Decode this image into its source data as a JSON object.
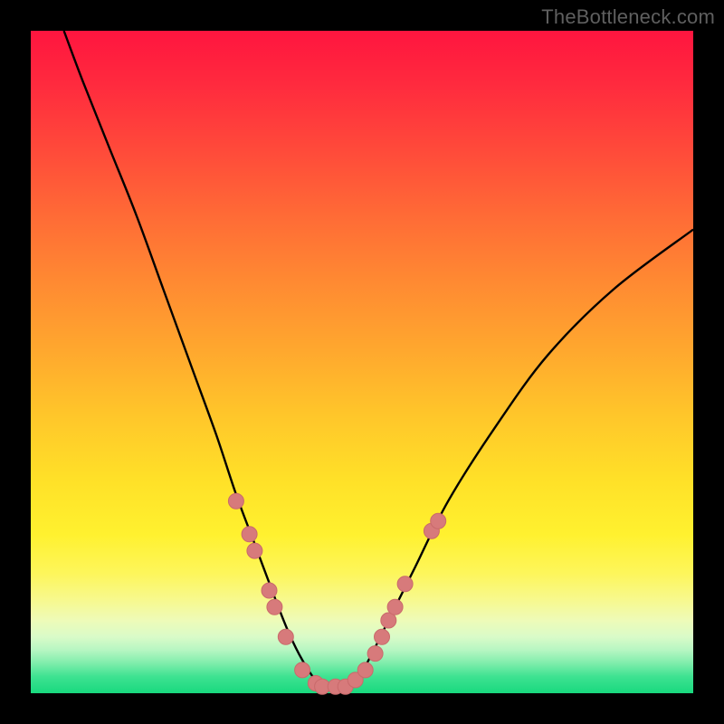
{
  "watermark": "TheBottleneck.com",
  "colors": {
    "frame": "#000000",
    "curve": "#000000",
    "marker_fill": "#d77a7b",
    "marker_stroke": "#c96a6b"
  },
  "chart_data": {
    "type": "line",
    "title": "",
    "xlabel": "",
    "ylabel": "",
    "xlim": [
      0,
      100
    ],
    "ylim": [
      0,
      100
    ],
    "grid": false,
    "legend": false,
    "annotations": [
      "TheBottleneck.com"
    ],
    "series": [
      {
        "name": "bottleneck-curve",
        "x": [
          5,
          8,
          12,
          16,
          20,
          24,
          28,
          31,
          34,
          37,
          39,
          41,
          43,
          45,
          47,
          49,
          51,
          54,
          58,
          63,
          70,
          78,
          88,
          100
        ],
        "y": [
          100,
          92,
          82,
          72,
          61,
          50,
          39,
          30,
          22,
          14,
          9,
          5,
          2,
          1,
          1,
          2,
          5,
          11,
          19,
          29,
          40,
          51,
          61,
          70
        ]
      }
    ],
    "markers": [
      {
        "x": 31.0,
        "y": 29.0
      },
      {
        "x": 33.0,
        "y": 24.0
      },
      {
        "x": 33.8,
        "y": 21.5
      },
      {
        "x": 36.0,
        "y": 15.5
      },
      {
        "x": 36.8,
        "y": 13.0
      },
      {
        "x": 38.5,
        "y": 8.5
      },
      {
        "x": 41.0,
        "y": 3.5
      },
      {
        "x": 43.0,
        "y": 1.5
      },
      {
        "x": 44.0,
        "y": 1.0
      },
      {
        "x": 46.0,
        "y": 1.0
      },
      {
        "x": 47.5,
        "y": 1.0
      },
      {
        "x": 49.0,
        "y": 2.0
      },
      {
        "x": 50.5,
        "y": 3.5
      },
      {
        "x": 52.0,
        "y": 6.0
      },
      {
        "x": 53.0,
        "y": 8.5
      },
      {
        "x": 54.0,
        "y": 11.0
      },
      {
        "x": 55.0,
        "y": 13.0
      },
      {
        "x": 56.5,
        "y": 16.5
      },
      {
        "x": 60.5,
        "y": 24.5
      },
      {
        "x": 61.5,
        "y": 26.0
      }
    ]
  }
}
